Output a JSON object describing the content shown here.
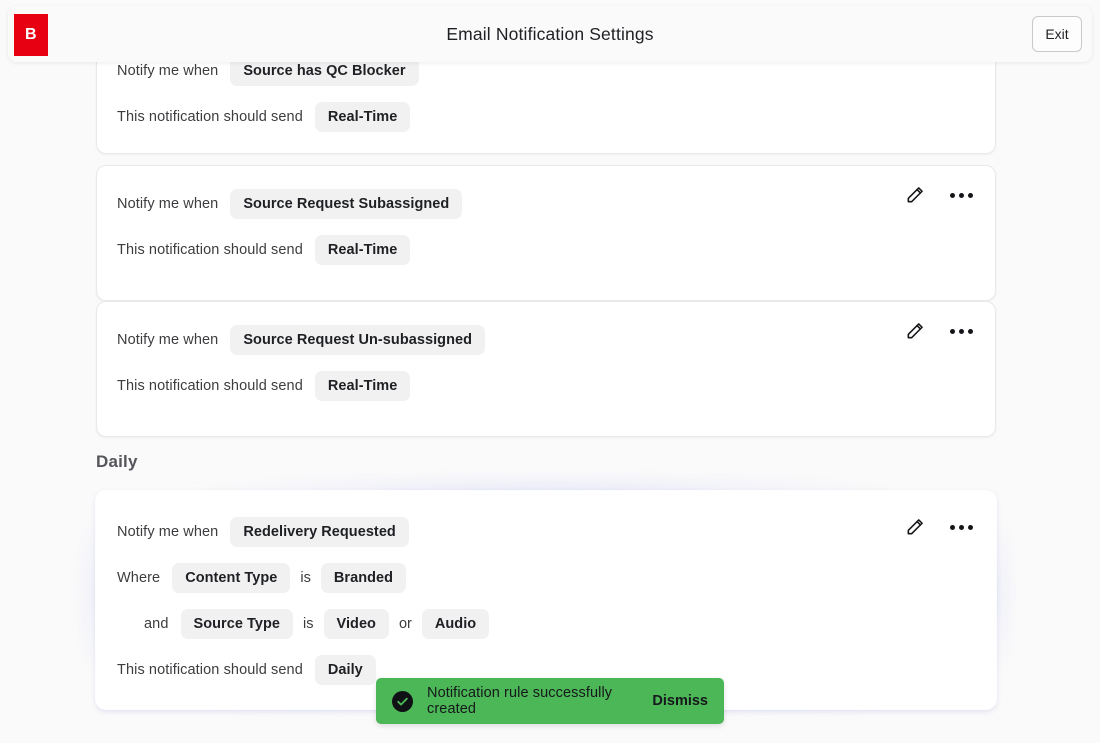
{
  "header": {
    "logo_text": "B",
    "logo_color": "#e60012",
    "title": "Email Notification Settings",
    "exit_label": "Exit"
  },
  "labels": {
    "notify_prefix": "Notify me when",
    "send_prefix": "This notification should send",
    "where": "Where",
    "and": "and",
    "is": "is",
    "or": "or"
  },
  "sections": [
    {
      "title": "",
      "rules": [
        {
          "trigger": "Source has QC Blocker",
          "schedule": "Real-Time",
          "conditions": [],
          "highlighted": false,
          "edit_icon": "calendar-icon",
          "menu_icon": "more-horizontal-icon"
        },
        {
          "trigger": "Source Request Subassigned",
          "schedule": "Real-Time",
          "conditions": [],
          "highlighted": false,
          "edit_icon": "pencil-icon",
          "menu_icon": "more-horizontal-icon"
        },
        {
          "trigger": "Source Request Un-subassigned",
          "schedule": "Real-Time",
          "conditions": [],
          "highlighted": false,
          "edit_icon": "pencil-icon",
          "menu_icon": "more-horizontal-icon"
        }
      ]
    },
    {
      "title": "Daily",
      "rules": [
        {
          "trigger": "Redelivery Requested",
          "schedule": "Daily",
          "conditions": [
            {
              "conjunction": "Where",
              "field": "Content Type",
              "operator": "is",
              "values": [
                "Branded"
              ],
              "value_joiner": ""
            },
            {
              "conjunction": "and",
              "field": "Source Type",
              "operator": "is",
              "values": [
                "Video",
                "Audio"
              ],
              "value_joiner": "or"
            }
          ],
          "highlighted": true,
          "edit_icon": "pencil-icon",
          "menu_icon": "more-horizontal-icon"
        }
      ]
    }
  ],
  "toast": {
    "message": "Notification rule successfully created",
    "action_label": "Dismiss",
    "icon": "check-circle-icon",
    "background": "#4cb757"
  }
}
